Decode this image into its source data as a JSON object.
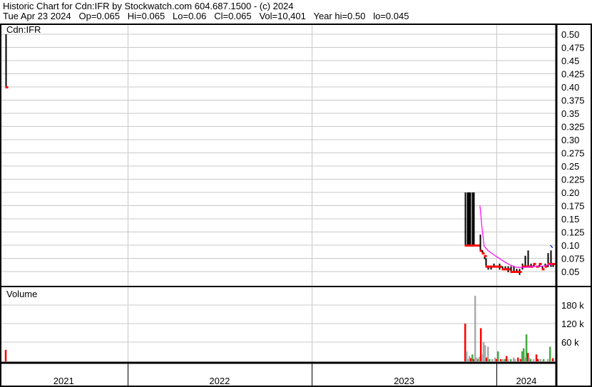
{
  "header": {
    "title": "Historic Chart for Cdn:IFR by Stockwatch.com 604.687.1500 - (c) 2024",
    "quote": "Tue Apr 23 2024   Op=0.065   Hi=0.065   Lo=0.06   Cl=0.065   Vol=10,401   Year hi=0.50   lo=0.045"
  },
  "chart_data": [
    {
      "type": "bar",
      "title": "Cdn:IFR",
      "subtype": "ohlc",
      "yticks": [
        "0.50",
        "0.475",
        "0.45",
        "0.425",
        "0.40",
        "0.375",
        "0.35",
        "0.325",
        "0.30",
        "0.275",
        "0.25",
        "0.225",
        "0.20",
        "0.175",
        "0.15",
        "0.125",
        "0.10",
        "0.075",
        "0.05"
      ],
      "ylim": [
        0.05,
        0.5
      ],
      "xlim": [
        2021.31,
        2024.325
      ],
      "xticks": [
        "2021",
        "2022",
        "2023",
        "2024"
      ],
      "colors": {
        "bar": "#000000",
        "close": "#ff0000",
        "ma": "#ff00ff",
        "ma2": "#0000cc",
        "grid": "#c8c8c8"
      },
      "bars": [
        [
          2021.34,
          0.5,
          0.4,
          0.4
        ],
        [
          2023.83,
          0.2,
          0.1,
          0.1
        ],
        [
          2023.842,
          0.2,
          0.1,
          0.1
        ],
        [
          2023.849,
          0.2,
          0.1,
          0.1
        ],
        [
          2023.857,
          0.2,
          0.1,
          0.1
        ],
        [
          2023.869,
          0.2,
          0.1,
          0.1
        ],
        [
          2023.876,
          0.2,
          0.1,
          0.1
        ],
        [
          2023.888,
          0.1,
          0.1,
          0.1
        ],
        [
          2023.9,
          0.1,
          0.1,
          0.1
        ],
        [
          2023.911,
          0.12,
          0.09,
          0.09
        ],
        [
          2023.923,
          0.09,
          0.085,
          0.085
        ],
        [
          2023.934,
          0.08,
          0.075,
          0.08
        ],
        [
          2023.942,
          0.075,
          0.06,
          0.06
        ],
        [
          2023.954,
          0.06,
          0.055,
          0.06
        ],
        [
          2023.969,
          0.06,
          0.055,
          0.06
        ],
        [
          2023.985,
          0.065,
          0.06,
          0.06
        ],
        [
          2024.0,
          0.06,
          0.06,
          0.06
        ],
        [
          2024.015,
          0.065,
          0.055,
          0.06
        ],
        [
          2024.031,
          0.06,
          0.055,
          0.055
        ],
        [
          2024.046,
          0.06,
          0.055,
          0.055
        ],
        [
          2024.062,
          0.06,
          0.05,
          0.055
        ],
        [
          2024.077,
          0.06,
          0.05,
          0.05
        ],
        [
          2024.093,
          0.06,
          0.05,
          0.05
        ],
        [
          2024.108,
          0.055,
          0.05,
          0.05
        ],
        [
          2024.124,
          0.055,
          0.045,
          0.05
        ],
        [
          2024.139,
          0.065,
          0.055,
          0.06
        ],
        [
          2024.154,
          0.08,
          0.06,
          0.06
        ],
        [
          2024.17,
          0.09,
          0.06,
          0.06
        ],
        [
          2024.185,
          0.065,
          0.06,
          0.06
        ],
        [
          2024.201,
          0.065,
          0.06,
          0.065
        ],
        [
          2024.216,
          0.06,
          0.06,
          0.06
        ],
        [
          2024.232,
          0.065,
          0.06,
          0.065
        ],
        [
          2024.247,
          0.06,
          0.055,
          0.055
        ],
        [
          2024.263,
          0.065,
          0.06,
          0.06
        ],
        [
          2024.278,
          0.085,
          0.06,
          0.065
        ],
        [
          2024.293,
          0.09,
          0.06,
          0.065
        ],
        [
          2024.305,
          0.065,
          0.06,
          0.065
        ]
      ],
      "moving_average": [
        [
          2023.911,
          0.175
        ],
        [
          2023.923,
          0.13
        ],
        [
          2023.934,
          0.098
        ],
        [
          2023.954,
          0.09
        ],
        [
          2023.985,
          0.082
        ],
        [
          2024.015,
          0.075
        ],
        [
          2024.046,
          0.068
        ],
        [
          2024.077,
          0.062
        ],
        [
          2024.108,
          0.058
        ],
        [
          2024.154,
          0.058
        ],
        [
          2024.201,
          0.06
        ],
        [
          2024.247,
          0.06
        ],
        [
          2024.278,
          0.062
        ],
        [
          2024.305,
          0.065
        ]
      ],
      "moving_average_2": [
        [
          2024.293,
          0.1
        ],
        [
          2024.305,
          0.095
        ]
      ]
    },
    {
      "type": "bar",
      "title": "Volume",
      "yticks": [
        "180 k",
        "120 k",
        "60 k"
      ],
      "ytick_values": [
        180,
        120,
        60
      ],
      "ylim": [
        0,
        230
      ],
      "bars": [
        [
          2021.34,
          35,
          "#ff0000"
        ],
        [
          2023.83,
          120,
          "#ff0000"
        ],
        [
          2023.838,
          30,
          "#aaaaaa"
        ],
        [
          2023.846,
          5,
          "#aaaaaa"
        ],
        [
          2023.853,
          15,
          "#aaaaaa"
        ],
        [
          2023.861,
          8,
          "#ff0000"
        ],
        [
          2023.869,
          20,
          "#44aa44"
        ],
        [
          2023.876,
          5,
          "#ff0000"
        ],
        [
          2023.884,
          210,
          "#aaaaaa"
        ],
        [
          2023.892,
          10,
          "#aaaaaa"
        ],
        [
          2023.9,
          5,
          "#44aa44"
        ],
        [
          2023.907,
          12,
          "#aaaaaa"
        ],
        [
          2023.915,
          105,
          "#ff0000"
        ],
        [
          2023.923,
          20,
          "#aaaaaa"
        ],
        [
          2023.93,
          60,
          "#aaaaaa"
        ],
        [
          2023.938,
          50,
          "#aaaaaa"
        ],
        [
          2023.946,
          10,
          "#ff0000"
        ],
        [
          2023.954,
          45,
          "#aaaaaa"
        ],
        [
          2023.962,
          5,
          "#44aa44"
        ],
        [
          2023.977,
          5,
          "#aaaaaa"
        ],
        [
          2023.992,
          10,
          "#aaaaaa"
        ],
        [
          2024.0,
          5,
          "#ff0000"
        ],
        [
          2024.008,
          30,
          "#44aa44"
        ],
        [
          2024.023,
          5,
          "#ff0000"
        ],
        [
          2024.035,
          5,
          "#aaaaaa"
        ],
        [
          2024.046,
          5,
          "#44aa44"
        ],
        [
          2024.054,
          15,
          "#ff0000"
        ],
        [
          2024.062,
          5,
          "#aaaaaa"
        ],
        [
          2024.077,
          5,
          "#44aa44"
        ],
        [
          2024.093,
          10,
          "#aaaaaa"
        ],
        [
          2024.1,
          5,
          "#aaaaaa"
        ],
        [
          2024.116,
          10,
          "#ff0000"
        ],
        [
          2024.131,
          5,
          "#ff0000"
        ],
        [
          2024.139,
          30,
          "#44aa44"
        ],
        [
          2024.147,
          40,
          "#44aa44"
        ],
        [
          2024.154,
          10,
          "#aaaaaa"
        ],
        [
          2024.162,
          85,
          "#44aa44"
        ],
        [
          2024.17,
          25,
          "#ff0000"
        ],
        [
          2024.177,
          10,
          "#aaaaaa"
        ],
        [
          2024.185,
          5,
          "#44aa44"
        ],
        [
          2024.201,
          5,
          "#aaaaaa"
        ],
        [
          2024.216,
          20,
          "#ff0000"
        ],
        [
          2024.224,
          5,
          "#ff0000"
        ],
        [
          2024.239,
          5,
          "#aaaaaa"
        ],
        [
          2024.255,
          5,
          "#44aa44"
        ],
        [
          2024.278,
          5,
          "#aaaaaa"
        ],
        [
          2024.29,
          45,
          "#44aa44"
        ],
        [
          2024.305,
          8,
          "#ff0000"
        ]
      ]
    }
  ]
}
